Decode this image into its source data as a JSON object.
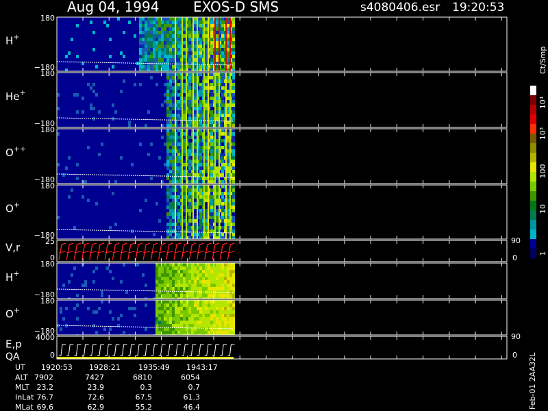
{
  "header": {
    "date": "Aug 04, 1994",
    "instrument": "EXOS-D SMS",
    "file": "s4080406.esr",
    "time": "19:20:53"
  },
  "colorbar": {
    "title": "Ct/Smp",
    "labels": [
      "10⁴",
      "10³",
      "100",
      "10",
      "1"
    ],
    "colors": [
      "#ffffff",
      "#7a0000",
      "#b40000",
      "#e00000",
      "#ff3000",
      "#7a5a00",
      "#8c8c00",
      "#b4b400",
      "#e6e600",
      "#b4e600",
      "#7ac800",
      "#3c9600",
      "#007814",
      "#007850",
      "#0096a0",
      "#00b4c8",
      "#000090",
      "#000060"
    ]
  },
  "panels": [
    {
      "id": "h-plus",
      "label_main": "H",
      "label_sup": "+",
      "tick_top": "180",
      "tick_bottom": "−180",
      "kind": "spectrogram"
    },
    {
      "id": "he-plus",
      "label_main": "He",
      "label_sup": "+",
      "tick_top": "180",
      "tick_bottom": "−180",
      "kind": "spectrogram"
    },
    {
      "id": "o-plusplus",
      "label_main": "O",
      "label_sup": "++",
      "tick_top": "180",
      "tick_bottom": "−180",
      "kind": "spectrogram"
    },
    {
      "id": "o-plus",
      "label_main": "O",
      "label_sup": "+",
      "tick_top": "180",
      "tick_bottom": "−180",
      "kind": "spectrogram"
    },
    {
      "id": "vr",
      "label_main": "V,r",
      "label_sup": "",
      "tick_top": "25",
      "tick_bottom": "0",
      "right_top": "90",
      "right_bottom": "0",
      "kind": "vr"
    },
    {
      "id": "h-plus-2",
      "label_main": "H",
      "label_sup": "+",
      "tick_top": "180",
      "tick_bottom": "−180",
      "kind": "spectrogram2"
    },
    {
      "id": "o-plus-2",
      "label_main": "O",
      "label_sup": "+",
      "tick_top": "180",
      "tick_bottom": "−180",
      "kind": "spectrogram2"
    },
    {
      "id": "ep-qa",
      "label_main": "E,p",
      "label_sub": "QA",
      "tick_top": "4000",
      "tick_bottom": "0",
      "right_top": "90",
      "right_bottom": "0",
      "kind": "ep"
    }
  ],
  "footer": {
    "rows": [
      {
        "label": "UT",
        "values": [
          "1920:53",
          "1928:21",
          "1935:49",
          "1943:17"
        ]
      },
      {
        "label": "ALT",
        "values": [
          "7902",
          "7427",
          "6810",
          "6054"
        ]
      },
      {
        "label": "MLT",
        "values": [
          "23.2",
          "23.9",
          "0.3",
          "0.7"
        ]
      },
      {
        "label": "InLat",
        "values": [
          "76.7",
          "72.6",
          "67.5",
          "61.3"
        ]
      },
      {
        "label": "MLat",
        "values": [
          "69.6",
          "62.9",
          "55.2",
          "46.4"
        ]
      }
    ],
    "side_note": "Feb-01 2AA32L"
  },
  "chart_data": {
    "type": "heatmap",
    "title": "Aug 04, 1994   EXOS-D SMS",
    "x_tick_labels": [
      "1920:53",
      "1928:21",
      "1935:49",
      "1943:17"
    ],
    "panel_y_ranges": {
      "H+": [
        -180,
        180
      ],
      "He+": [
        -180,
        180
      ],
      "O++": [
        -180,
        180
      ],
      "O+": [
        -180,
        180
      ],
      "V,r": [
        0,
        25
      ],
      "E,p": [
        0,
        4000
      ]
    },
    "colorbar_scale": "log",
    "colorbar_range": [
      1,
      10000
    ]
  }
}
